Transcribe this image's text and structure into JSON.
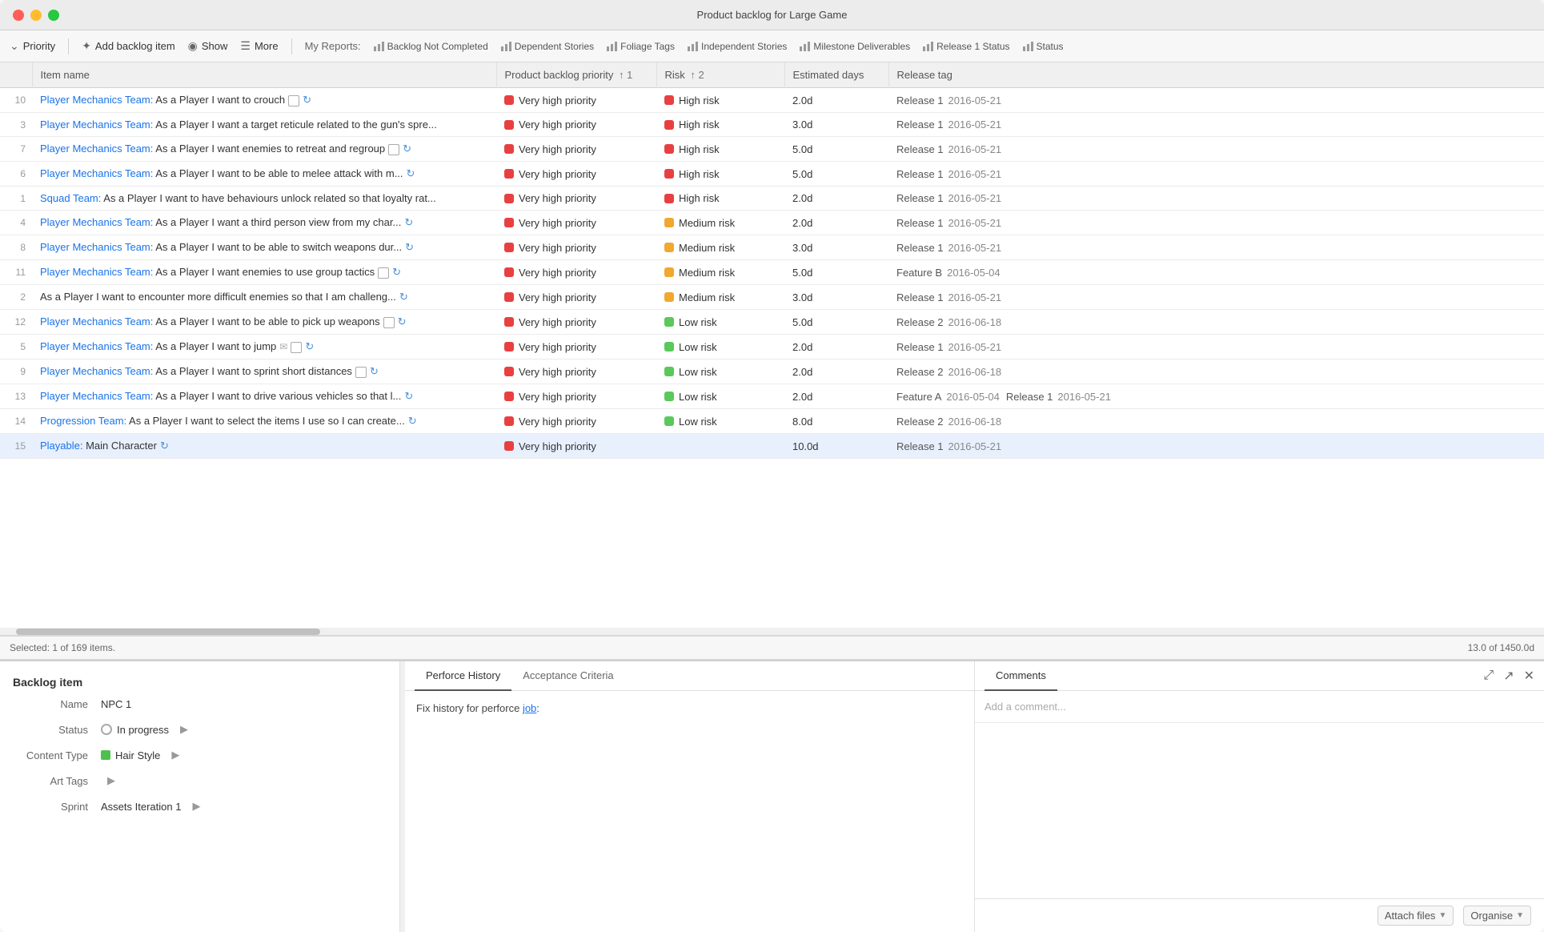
{
  "window": {
    "title": "Product backlog for Large Game"
  },
  "toolbar": {
    "priority_label": "Priority",
    "add_backlog_label": "Add backlog item",
    "show_label": "Show",
    "more_label": "More",
    "my_reports_label": "My Reports:",
    "reports": [
      {
        "id": "backlog-not-completed",
        "label": "Backlog Not Completed"
      },
      {
        "id": "dependent-stories",
        "label": "Dependent Stories"
      },
      {
        "id": "foliage-tags",
        "label": "Foliage Tags"
      },
      {
        "id": "independent-stories",
        "label": "Independent Stories"
      },
      {
        "id": "milestone-deliverables",
        "label": "Milestone Deliverables"
      },
      {
        "id": "release-1-status",
        "label": "Release 1 Status"
      },
      {
        "id": "status",
        "label": "Status"
      }
    ]
  },
  "table": {
    "columns": [
      {
        "id": "num",
        "label": ""
      },
      {
        "id": "item-name",
        "label": "Item name"
      },
      {
        "id": "priority",
        "label": "Product backlog priority",
        "sort": "1",
        "sortable": true
      },
      {
        "id": "risk",
        "label": "Risk",
        "sort": "2",
        "sortable": true
      },
      {
        "id": "days",
        "label": "Estimated days"
      },
      {
        "id": "release",
        "label": "Release tag"
      }
    ],
    "rows": [
      {
        "num": "10",
        "name": "Player Mechanics Team: As a Player I want to crouch",
        "name_has_checkbox": true,
        "name_has_refresh": true,
        "priority": "Very high priority",
        "priority_color": "red",
        "risk": "High risk",
        "risk_color": "red",
        "days": "2.0d",
        "release_tags": [
          {
            "label": "Release 1",
            "date": "2016-05-21"
          }
        ]
      },
      {
        "num": "3",
        "name": "Player Mechanics Team: As a Player I want a target reticule related to the gun's spre...",
        "priority": "Very high priority",
        "priority_color": "red",
        "risk": "High risk",
        "risk_color": "red",
        "days": "3.0d",
        "release_tags": [
          {
            "label": "Release 1",
            "date": "2016-05-21"
          }
        ]
      },
      {
        "num": "7",
        "name": "Player Mechanics Team: As a Player I want enemies to retreat and regroup",
        "name_has_checkbox": true,
        "name_has_refresh": true,
        "priority": "Very high priority",
        "priority_color": "red",
        "risk": "High risk",
        "risk_color": "red",
        "days": "5.0d",
        "release_tags": [
          {
            "label": "Release 1",
            "date": "2016-05-21"
          }
        ]
      },
      {
        "num": "6",
        "name": "Player Mechanics Team: As a Player I want to be able to melee attack with m...",
        "name_has_refresh": true,
        "priority": "Very high priority",
        "priority_color": "red",
        "risk": "High risk",
        "risk_color": "red",
        "days": "5.0d",
        "release_tags": [
          {
            "label": "Release 1",
            "date": "2016-05-21"
          }
        ]
      },
      {
        "num": "1",
        "name": "Squad Team: As a Player I want to have behaviours unlock related so that loyalty rat...",
        "priority": "Very high priority",
        "priority_color": "red",
        "risk": "High risk",
        "risk_color": "red",
        "days": "2.0d",
        "release_tags": [
          {
            "label": "Release 1",
            "date": "2016-05-21"
          }
        ]
      },
      {
        "num": "4",
        "name": "Player Mechanics Team: As a Player I want a third person view from my char...",
        "name_has_refresh": true,
        "priority": "Very high priority",
        "priority_color": "red",
        "risk": "Medium risk",
        "risk_color": "yellow",
        "days": "2.0d",
        "release_tags": [
          {
            "label": "Release 1",
            "date": "2016-05-21"
          }
        ]
      },
      {
        "num": "8",
        "name": "Player Mechanics Team: As a Player I want to be able to switch weapons dur...",
        "name_has_refresh": true,
        "priority": "Very high priority",
        "priority_color": "red",
        "risk": "Medium risk",
        "risk_color": "yellow",
        "days": "3.0d",
        "release_tags": [
          {
            "label": "Release 1",
            "date": "2016-05-21"
          }
        ]
      },
      {
        "num": "11",
        "name": "Player Mechanics Team: As a Player I want enemies to use group tactics",
        "name_has_checkbox": true,
        "name_has_refresh": true,
        "priority": "Very high priority",
        "priority_color": "red",
        "risk": "Medium risk",
        "risk_color": "yellow",
        "days": "5.0d",
        "release_tags": [
          {
            "label": "Feature B",
            "date": "2016-05-04"
          }
        ]
      },
      {
        "num": "2",
        "name": "As a Player I want to encounter more difficult enemies so that I am challeng...",
        "name_has_refresh": true,
        "priority": "Very high priority",
        "priority_color": "red",
        "risk": "Medium risk",
        "risk_color": "yellow",
        "days": "3.0d",
        "release_tags": [
          {
            "label": "Release 1",
            "date": "2016-05-21"
          }
        ]
      },
      {
        "num": "12",
        "name": "Player Mechanics Team: As a Player I want to be able to pick up weapons",
        "name_has_checkbox": true,
        "name_has_refresh": true,
        "priority": "Very high priority",
        "priority_color": "red",
        "risk": "Low risk",
        "risk_color": "green",
        "days": "5.0d",
        "release_tags": [
          {
            "label": "Release 2",
            "date": "2016-06-18"
          }
        ]
      },
      {
        "num": "5",
        "name": "Player Mechanics Team: As a Player I want to jump",
        "name_has_email": true,
        "name_has_checkbox": true,
        "name_has_refresh": true,
        "priority": "Very high priority",
        "priority_color": "red",
        "risk": "Low risk",
        "risk_color": "green",
        "days": "2.0d",
        "release_tags": [
          {
            "label": "Release 1",
            "date": "2016-05-21"
          }
        ]
      },
      {
        "num": "9",
        "name": "Player Mechanics Team: As a Player I want to sprint short distances",
        "name_has_checkbox": true,
        "name_has_refresh": true,
        "priority": "Very high priority",
        "priority_color": "red",
        "risk": "Low risk",
        "risk_color": "green",
        "days": "2.0d",
        "release_tags": [
          {
            "label": "Release 2",
            "date": "2016-06-18"
          }
        ]
      },
      {
        "num": "13",
        "name": "Player Mechanics Team: As a Player I want to drive various vehicles so that l...",
        "name_has_refresh": true,
        "priority": "Very high priority",
        "priority_color": "red",
        "risk": "Low risk",
        "risk_color": "green",
        "days": "2.0d",
        "release_tags": [
          {
            "label": "Feature A",
            "date": "2016-05-04"
          },
          {
            "label": "Release 1",
            "date": "2016-05-21"
          }
        ]
      },
      {
        "num": "14",
        "name": "Progression Team: As a Player I want to select the items I use so I can create...",
        "name_has_refresh": true,
        "priority": "Very high priority",
        "priority_color": "red",
        "risk": "Low risk",
        "risk_color": "green",
        "days": "8.0d",
        "release_tags": [
          {
            "label": "Release 2",
            "date": "2016-06-18"
          }
        ]
      },
      {
        "num": "15",
        "name": "Playable: Main Character",
        "name_has_refresh": true,
        "priority": "Very high priority",
        "priority_color": "red",
        "risk": "",
        "risk_color": "",
        "days": "10.0d",
        "release_tags": [
          {
            "label": "Release 1",
            "date": "2016-05-21"
          }
        ]
      }
    ]
  },
  "status_bar": {
    "selection": "Selected: 1 of 169 items.",
    "total_days": "13.0 of 1450.0d"
  },
  "bottom_panel": {
    "title": "Backlog item",
    "form": {
      "name_label": "Name",
      "name_value": "NPC 1",
      "status_label": "Status",
      "status_value": "In progress",
      "content_type_label": "Content Type",
      "content_type_value": "Hair Style",
      "art_tags_label": "Art Tags",
      "art_tags_value": "",
      "sprint_label": "Sprint",
      "sprint_value": "Assets Iteration 1"
    },
    "tabs": [
      {
        "id": "perforce-history",
        "label": "Perforce History",
        "active": true
      },
      {
        "id": "acceptance-criteria",
        "label": "Acceptance Criteria",
        "active": false
      }
    ],
    "perforce_text": "Fix history for perforce ",
    "perforce_link": "job",
    "perforce_link_suffix": ":",
    "comments_tab": "Comments",
    "add_comment_placeholder": "Add a comment...",
    "attach_files_label": "Attach files",
    "organise_label": "Organise"
  }
}
